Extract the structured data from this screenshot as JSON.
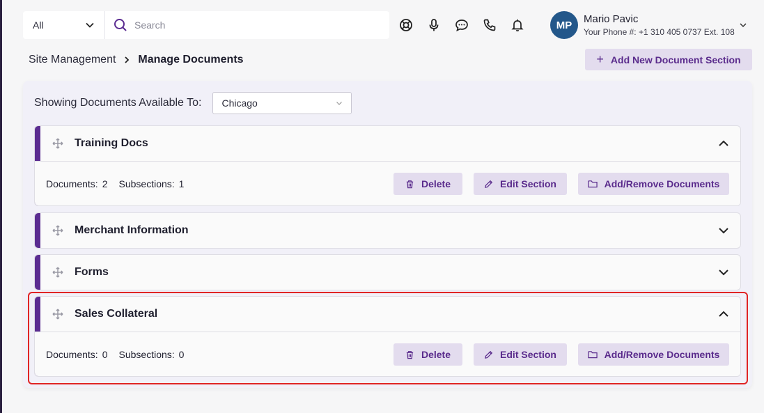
{
  "header": {
    "filter": {
      "selected": "All"
    },
    "search": {
      "placeholder": "Search",
      "value": ""
    },
    "icons": [
      "lifebuoy-icon",
      "microphone-icon",
      "chat-icon",
      "phone-icon",
      "bell-icon"
    ],
    "user": {
      "initials": "MP",
      "name": "Mario Pavic",
      "phone": "Your Phone #: +1 310 405 0737 Ext. 108"
    }
  },
  "breadcrumb": {
    "parent": "Site Management",
    "current": "Manage Documents"
  },
  "add_section_button": {
    "label": "Add New Document Section"
  },
  "availability": {
    "label": "Showing Documents Available To:",
    "selected": "Chicago"
  },
  "section_actions": {
    "delete": "Delete",
    "edit": "Edit Section",
    "add_remove": "Add/Remove Documents"
  },
  "sections": [
    {
      "title": "Training Docs",
      "expanded": true,
      "documents_label": "Documents:",
      "documents": "2",
      "subsections_label": "Subsections:",
      "subsections": "1"
    },
    {
      "title": "Merchant Information",
      "expanded": false
    },
    {
      "title": "Forms",
      "expanded": false
    },
    {
      "title": "Sales Collateral",
      "expanded": true,
      "documents_label": "Documents:",
      "documents": "0",
      "subsections_label": "Subsections:",
      "subsections": "0"
    }
  ],
  "colors": {
    "accent": "#5b2c91",
    "button_bg": "#e3dcee",
    "button_text": "#5a2b8c",
    "avatar": "#23578a",
    "highlight": "#e02424"
  }
}
